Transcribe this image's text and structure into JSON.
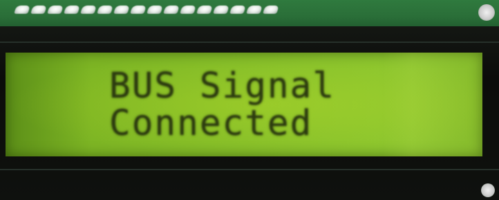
{
  "lcd": {
    "line1": "BUS Signal",
    "line2": "Connected"
  },
  "colors": {
    "pcb_green": "#2a6e38",
    "lcd_backlight": "#86bf2a",
    "lcd_text": "#2c3a10",
    "bezel": "#0c0e0b"
  },
  "icons": [
    "header-pin-icon",
    "mount-hole-icon"
  ]
}
